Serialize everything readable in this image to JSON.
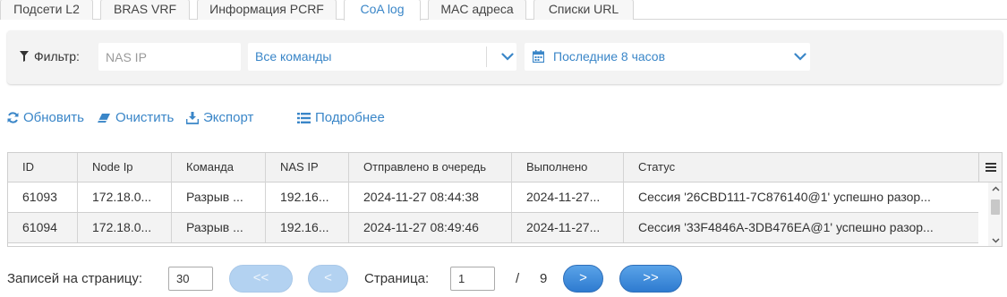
{
  "tabs": [
    {
      "label": "Подсети L2",
      "active": false
    },
    {
      "label": "BRAS VRF",
      "active": false
    },
    {
      "label": "Информация PCRF",
      "active": false
    },
    {
      "label": "CoA log",
      "active": true
    },
    {
      "label": "MAC адреса",
      "active": false
    },
    {
      "label": "Списки URL",
      "active": false
    }
  ],
  "filter": {
    "label": "Фильтр:",
    "nas_ip_placeholder": "NAS IP",
    "command_value": "Все команды",
    "period_value": "Последние 8 часов"
  },
  "toolbar": {
    "refresh": "Обновить",
    "clear": "Очистить",
    "export": "Экспорт",
    "details": "Подробнее"
  },
  "grid": {
    "columns": [
      "ID",
      "Node Ip",
      "Команда",
      "NAS IP",
      "Отправлено в очередь",
      "Выполнено",
      "Статус"
    ],
    "rows": [
      [
        "61093",
        "172.18.0...",
        "Разрыв ...",
        "192.16...",
        "2024-11-27 08:44:38",
        "2024-11-27...",
        "Сессия '26CBD111-7C876140@1' успешно разор..."
      ],
      [
        "61094",
        "172.18.0...",
        "Разрыв ...",
        "192.16...",
        "2024-11-27 08:49:46",
        "2024-11-27...",
        "Сессия '33F4846A-3DB476EA@1' успешно разор..."
      ]
    ]
  },
  "pager": {
    "per_page_label": "Записей на страницу:",
    "per_page_value": "30",
    "first": "<<",
    "prev": "<",
    "page_label": "Страница:",
    "page_value": "1",
    "separator": "/",
    "total_pages": "9",
    "next": ">",
    "last": ">>"
  },
  "colors": {
    "accent": "#3a86c8",
    "button": "#2e7bd0",
    "button_disabled": "#b3d2f1"
  }
}
